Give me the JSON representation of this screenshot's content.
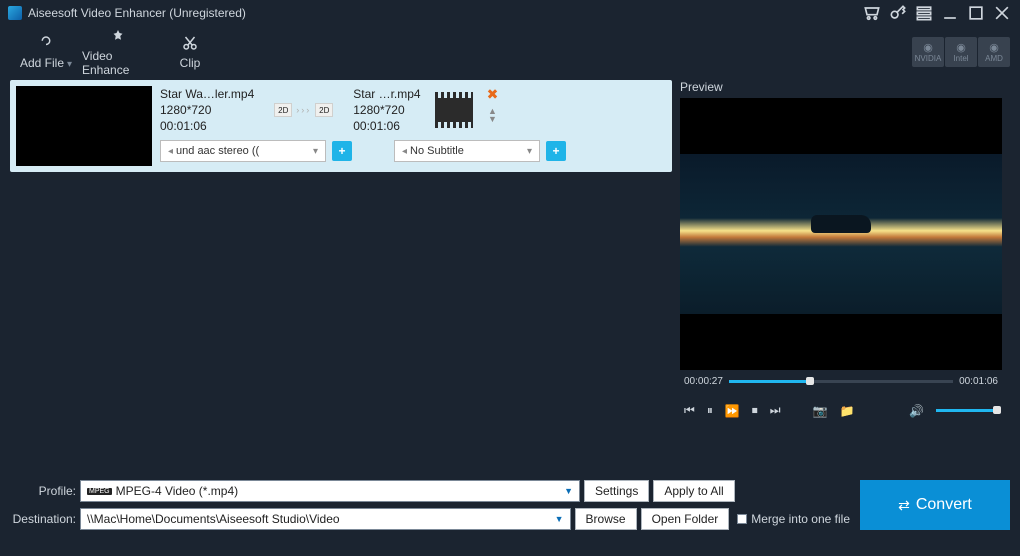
{
  "titlebar": {
    "app_title": "Aiseesoft Video Enhancer (Unregistered)"
  },
  "toolbar": {
    "add_file": "Add File",
    "video_enhance": "Video Enhance",
    "clip": "Clip"
  },
  "gpu": {
    "nvidia": "NVIDIA",
    "intel": "Intel",
    "amd": "AMD"
  },
  "item": {
    "src_name": "Star Wa…ler.mp4",
    "src_res": "1280*720",
    "src_dur": "00:01:06",
    "dst_name": "Star …r.mp4",
    "dst_res": "1280*720",
    "dst_dur": "00:01:06",
    "arrow_tag_left": "2D",
    "arrow_tag_right": "2D",
    "audio_sel": "und aac stereo ((",
    "subtitle_sel": "No Subtitle"
  },
  "preview": {
    "label": "Preview",
    "time_cur": "00:00:27",
    "time_total": "00:01:06"
  },
  "bottom": {
    "profile_label": "Profile:",
    "profile_icon_text": "MPEG",
    "profile_value": "MPEG-4 Video (*.mp4)",
    "settings_btn": "Settings",
    "apply_all_btn": "Apply to All",
    "dest_label": "Destination:",
    "dest_value": "\\\\Mac\\Home\\Documents\\Aiseesoft Studio\\Video",
    "browse_btn": "Browse",
    "open_folder_btn": "Open Folder",
    "merge_label": "Merge into one file",
    "convert_btn": "Convert"
  }
}
